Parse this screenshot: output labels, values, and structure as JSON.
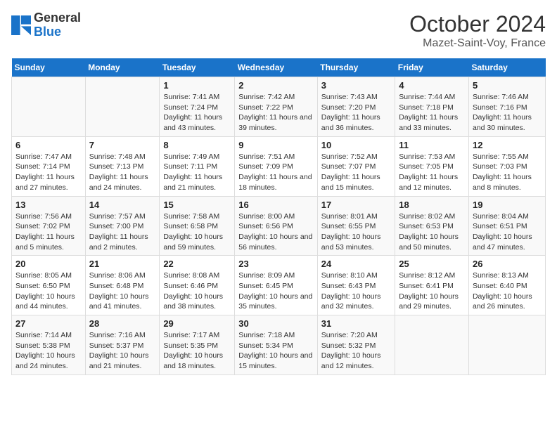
{
  "header": {
    "logo_general": "General",
    "logo_blue": "Blue",
    "title": "October 2024",
    "subtitle": "Mazet-Saint-Voy, France"
  },
  "columns": [
    "Sunday",
    "Monday",
    "Tuesday",
    "Wednesday",
    "Thursday",
    "Friday",
    "Saturday"
  ],
  "rows": [
    [
      {
        "day": "",
        "info": ""
      },
      {
        "day": "",
        "info": ""
      },
      {
        "day": "1",
        "info": "Sunrise: 7:41 AM\nSunset: 7:24 PM\nDaylight: 11 hours and 43 minutes."
      },
      {
        "day": "2",
        "info": "Sunrise: 7:42 AM\nSunset: 7:22 PM\nDaylight: 11 hours and 39 minutes."
      },
      {
        "day": "3",
        "info": "Sunrise: 7:43 AM\nSunset: 7:20 PM\nDaylight: 11 hours and 36 minutes."
      },
      {
        "day": "4",
        "info": "Sunrise: 7:44 AM\nSunset: 7:18 PM\nDaylight: 11 hours and 33 minutes."
      },
      {
        "day": "5",
        "info": "Sunrise: 7:46 AM\nSunset: 7:16 PM\nDaylight: 11 hours and 30 minutes."
      }
    ],
    [
      {
        "day": "6",
        "info": "Sunrise: 7:47 AM\nSunset: 7:14 PM\nDaylight: 11 hours and 27 minutes."
      },
      {
        "day": "7",
        "info": "Sunrise: 7:48 AM\nSunset: 7:13 PM\nDaylight: 11 hours and 24 minutes."
      },
      {
        "day": "8",
        "info": "Sunrise: 7:49 AM\nSunset: 7:11 PM\nDaylight: 11 hours and 21 minutes."
      },
      {
        "day": "9",
        "info": "Sunrise: 7:51 AM\nSunset: 7:09 PM\nDaylight: 11 hours and 18 minutes."
      },
      {
        "day": "10",
        "info": "Sunrise: 7:52 AM\nSunset: 7:07 PM\nDaylight: 11 hours and 15 minutes."
      },
      {
        "day": "11",
        "info": "Sunrise: 7:53 AM\nSunset: 7:05 PM\nDaylight: 11 hours and 12 minutes."
      },
      {
        "day": "12",
        "info": "Sunrise: 7:55 AM\nSunset: 7:03 PM\nDaylight: 11 hours and 8 minutes."
      }
    ],
    [
      {
        "day": "13",
        "info": "Sunrise: 7:56 AM\nSunset: 7:02 PM\nDaylight: 11 hours and 5 minutes."
      },
      {
        "day": "14",
        "info": "Sunrise: 7:57 AM\nSunset: 7:00 PM\nDaylight: 11 hours and 2 minutes."
      },
      {
        "day": "15",
        "info": "Sunrise: 7:58 AM\nSunset: 6:58 PM\nDaylight: 10 hours and 59 minutes."
      },
      {
        "day": "16",
        "info": "Sunrise: 8:00 AM\nSunset: 6:56 PM\nDaylight: 10 hours and 56 minutes."
      },
      {
        "day": "17",
        "info": "Sunrise: 8:01 AM\nSunset: 6:55 PM\nDaylight: 10 hours and 53 minutes."
      },
      {
        "day": "18",
        "info": "Sunrise: 8:02 AM\nSunset: 6:53 PM\nDaylight: 10 hours and 50 minutes."
      },
      {
        "day": "19",
        "info": "Sunrise: 8:04 AM\nSunset: 6:51 PM\nDaylight: 10 hours and 47 minutes."
      }
    ],
    [
      {
        "day": "20",
        "info": "Sunrise: 8:05 AM\nSunset: 6:50 PM\nDaylight: 10 hours and 44 minutes."
      },
      {
        "day": "21",
        "info": "Sunrise: 8:06 AM\nSunset: 6:48 PM\nDaylight: 10 hours and 41 minutes."
      },
      {
        "day": "22",
        "info": "Sunrise: 8:08 AM\nSunset: 6:46 PM\nDaylight: 10 hours and 38 minutes."
      },
      {
        "day": "23",
        "info": "Sunrise: 8:09 AM\nSunset: 6:45 PM\nDaylight: 10 hours and 35 minutes."
      },
      {
        "day": "24",
        "info": "Sunrise: 8:10 AM\nSunset: 6:43 PM\nDaylight: 10 hours and 32 minutes."
      },
      {
        "day": "25",
        "info": "Sunrise: 8:12 AM\nSunset: 6:41 PM\nDaylight: 10 hours and 29 minutes."
      },
      {
        "day": "26",
        "info": "Sunrise: 8:13 AM\nSunset: 6:40 PM\nDaylight: 10 hours and 26 minutes."
      }
    ],
    [
      {
        "day": "27",
        "info": "Sunrise: 7:14 AM\nSunset: 5:38 PM\nDaylight: 10 hours and 24 minutes."
      },
      {
        "day": "28",
        "info": "Sunrise: 7:16 AM\nSunset: 5:37 PM\nDaylight: 10 hours and 21 minutes."
      },
      {
        "day": "29",
        "info": "Sunrise: 7:17 AM\nSunset: 5:35 PM\nDaylight: 10 hours and 18 minutes."
      },
      {
        "day": "30",
        "info": "Sunrise: 7:18 AM\nSunset: 5:34 PM\nDaylight: 10 hours and 15 minutes."
      },
      {
        "day": "31",
        "info": "Sunrise: 7:20 AM\nSunset: 5:32 PM\nDaylight: 10 hours and 12 minutes."
      },
      {
        "day": "",
        "info": ""
      },
      {
        "day": "",
        "info": ""
      }
    ]
  ]
}
